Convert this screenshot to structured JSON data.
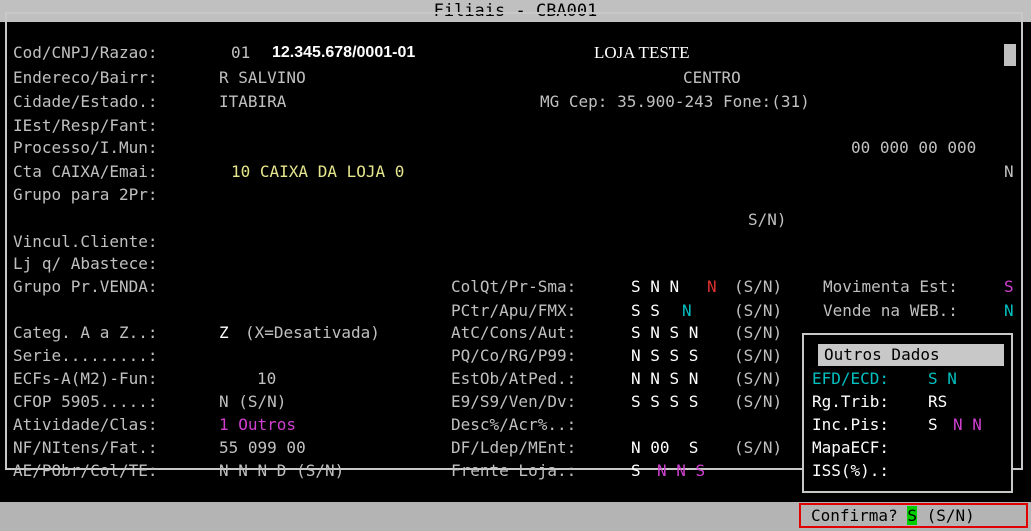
{
  "window": {
    "title": "Filiais - CBA001"
  },
  "form": {
    "cod_label": "Cod/CNPJ/Razao:",
    "cod": "01",
    "cnpj": "12.345.678/0001-01",
    "razao": "LOJA TESTE",
    "endereco_label": "Endereco/Bairr:",
    "endereco": "R SALVINO",
    "bairro": "CENTRO",
    "cidade_label": "Cidade/Estado.:",
    "cidade": "ITABIRA",
    "estado_cep_fone": "MG Cep: 35.900-243 Fone:(31)",
    "iest_label": "IEst/Resp/Fant:",
    "processo_label": "Processo/I.Mun:",
    "imun": "00 000 00 000",
    "cta_label": "Cta CAIXA/Emai:",
    "cta": "10 CAIXA DA LOJA 0",
    "cta_flag": "N",
    "grupo2_label": "Grupo para 2Pr:",
    "sn_hint": "S/N)",
    "vincul_label": "Vincul.Cliente:",
    "lj_label": "Lj q/ Abastece:",
    "grupo_venda_label": "Grupo Pr.VENDA:",
    "categ_label": "Categ. A a Z..:",
    "categ": "Z",
    "categ_hint": "(X=Desativada)",
    "serie_label": "Serie.........:",
    "ecfs_label": "ECFs-A(M2)-Fun:",
    "ecfs": "10",
    "cfop_label": "CFOP 5905.....:",
    "cfop": "N (S/N)",
    "atividade_label": "Atividade/Clas:",
    "atividade": "1 Outros",
    "nf_label": "NF/NItens/Fat.:",
    "nf": "55 099 00",
    "ae_label": "AE/PObr/Col/TE:",
    "ae": "N N N D (S/N)"
  },
  "flags": {
    "colqt_label": "ColQt/Pr-Sma:",
    "colqt_a": "S N N",
    "colqt_b": "N",
    "pctr_label": "PCtr/Apu/FMX:",
    "pctr_a": "S S",
    "pctr_b": "N",
    "atc_label": "AtC/Cons/Aut:",
    "atc": "S N S N",
    "pq_label": "PQ/Co/RG/P99:",
    "pq": "N S S S",
    "estob_label": "EstOb/AtPed.:",
    "estob": "N N S N",
    "e9_label": "E9/S9/Ven/Dv:",
    "e9": "S S S S",
    "desc_label": "Desc%/Acr%..:",
    "df_label": "DF/Ldep/MEnt:",
    "df": "N 00  S",
    "frente_label": "Frente Loja.:",
    "frente_a": "S",
    "frente_b": "N N S",
    "sn": "(S/N)",
    "movimenta_label": "Movimenta Est:",
    "movimenta": "S",
    "vende_label": "Vende na WEB.:",
    "vende": "N"
  },
  "outros": {
    "title": "Outros Dados",
    "efd_label": "EFD/ECD:",
    "efd": "S N",
    "rgtrib_label": "Rg.Trib:",
    "rgtrib": "RS",
    "incpis_label": "Inc.Pis:",
    "incpis_a": "S",
    "incpis_b": "N N",
    "mapa_label": "MapaECF:",
    "iss_label": "ISS(%).:"
  },
  "status": {
    "confirm_label": "Confirma?",
    "confirm_value": "S",
    "confirm_hint": "(S/N)"
  },
  "colors": {
    "accent_green": "#00d000",
    "highlight_red": "#e00000",
    "cyan": "#00c0c0",
    "magenta": "#d040d0",
    "yellow": "#e6e68c"
  }
}
